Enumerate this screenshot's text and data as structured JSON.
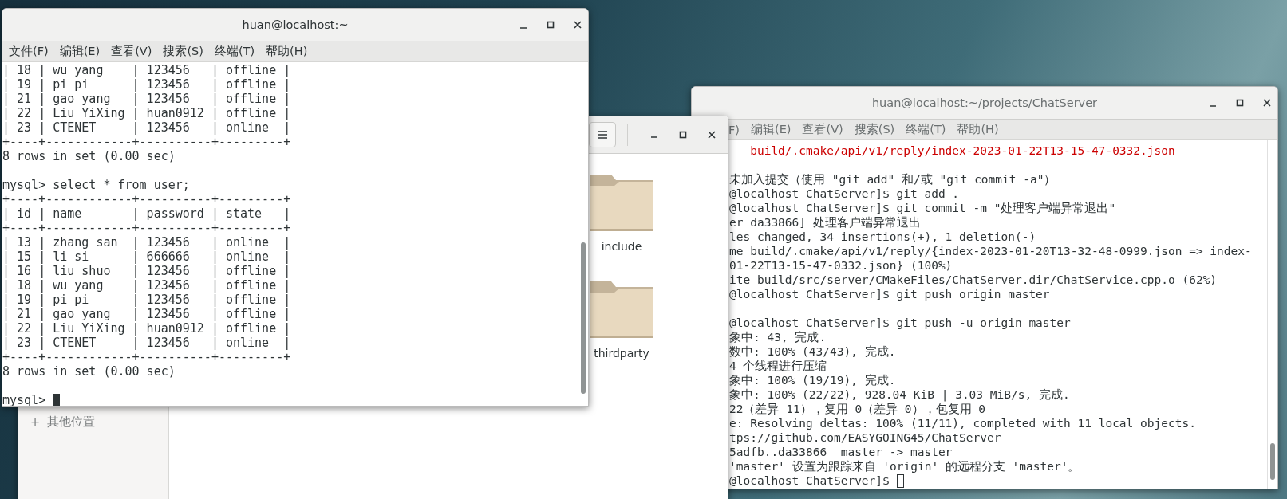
{
  "mysql_terminal": {
    "title": "huan@localhost:~",
    "focused": true,
    "menu": [
      "文件(F)",
      "编辑(E)",
      "查看(V)",
      "搜索(S)",
      "终端(T)",
      "帮助(H)"
    ],
    "lines": [
      {
        "text": "| 18 | wu yang    | 123456   | offline |",
        "kind": "normal"
      },
      {
        "text": "| 19 | pi pi      | 123456   | offline |",
        "kind": "normal"
      },
      {
        "text": "| 21 | gao yang   | 123456   | offline |",
        "kind": "normal"
      },
      {
        "text": "| 22 | Liu YiXing | huan0912 | offline |",
        "kind": "normal"
      },
      {
        "text": "| 23 | CTENET     | 123456   | online  |",
        "kind": "normal"
      },
      {
        "text": "+----+------------+----------+---------+",
        "kind": "normal"
      },
      {
        "text": "8 rows in set (0.00 sec)",
        "kind": "normal"
      },
      {
        "kind": "blank"
      },
      {
        "text": "mysql> select * from user;",
        "kind": "normal"
      },
      {
        "text": "+----+------------+----------+---------+",
        "kind": "normal"
      },
      {
        "text": "| id | name       | password | state   |",
        "kind": "normal"
      },
      {
        "text": "+----+------------+----------+---------+",
        "kind": "normal"
      },
      {
        "text": "| 13 | zhang san  | 123456   | online  |",
        "kind": "normal"
      },
      {
        "text": "| 15 | li si      | 666666   | online  |",
        "kind": "normal"
      },
      {
        "text": "| 16 | liu shuo   | 123456   | offline |",
        "kind": "normal"
      },
      {
        "text": "| 18 | wu yang    | 123456   | offline |",
        "kind": "normal"
      },
      {
        "text": "| 19 | pi pi      | 123456   | offline |",
        "kind": "normal"
      },
      {
        "text": "| 21 | gao yang   | 123456   | offline |",
        "kind": "normal"
      },
      {
        "text": "| 22 | Liu YiXing | huan0912 | offline |",
        "kind": "normal"
      },
      {
        "text": "| 23 | CTENET     | 123456   | online  |",
        "kind": "normal"
      },
      {
        "text": "+----+------------+----------+---------+",
        "kind": "normal"
      },
      {
        "text": "8 rows in set (0.00 sec)",
        "kind": "normal"
      },
      {
        "kind": "blank"
      },
      {
        "text": "mysql>",
        "kind": "prompt"
      }
    ]
  },
  "file_manager": {
    "sidebar": [
      {
        "icon": "+",
        "label": "其他位置"
      }
    ],
    "folders": [
      {
        "name": "include"
      },
      {
        "name": "thirdparty"
      }
    ]
  },
  "git_terminal": {
    "title": "huan@localhost:~/projects/ChatServer",
    "focused": false,
    "menu": [
      "F)",
      "编辑(E)",
      "查看(V)",
      "搜索(S)",
      "终端(T)",
      "帮助(H)"
    ],
    "lines": [
      {
        "text": "build/.cmake/api/v1/reply/index-2023-01-22T13-15-47-0332.json",
        "kind": "untracked"
      },
      {
        "kind": "blank"
      },
      {
        "text": "未加入提交（使用 \"git add\" 和/或 \"git commit -a\"）",
        "kind": "normal"
      },
      {
        "text": "@localhost ChatServer]$ git add .",
        "kind": "normal"
      },
      {
        "text": "@localhost ChatServer]$ git commit -m \"处理客户端异常退出\"",
        "kind": "normal"
      },
      {
        "text": "er da33866] 处理客户端异常退出",
        "kind": "normal"
      },
      {
        "text": "les changed, 34 insertions(+), 1 deletion(-)",
        "kind": "normal"
      },
      {
        "text": "me build/.cmake/api/v1/reply/{index-2023-01-20T13-32-48-0999.json => index-",
        "kind": "normal"
      },
      {
        "text": "01-22T13-15-47-0332.json} (100%)",
        "kind": "normal"
      },
      {
        "text": "ite build/src/server/CMakeFiles/ChatServer.dir/ChatService.cpp.o (62%)",
        "kind": "normal"
      },
      {
        "text": "@localhost ChatServer]$ git push origin master",
        "kind": "normal"
      },
      {
        "kind": "blank"
      },
      {
        "text": "@localhost ChatServer]$ git push -u origin master",
        "kind": "normal"
      },
      {
        "text": "象中: 43, 完成.",
        "kind": "normal"
      },
      {
        "text": "数中: 100% (43/43), 完成.",
        "kind": "normal"
      },
      {
        "text": "4 个线程进行压缩",
        "kind": "normal"
      },
      {
        "text": "象中: 100% (19/19), 完成.",
        "kind": "normal"
      },
      {
        "text": "象中: 100% (22/22), 928.04 KiB | 3.03 MiB/s, 完成.",
        "kind": "normal"
      },
      {
        "text": "22（差异 11），复用 0（差异 0），包复用 0",
        "kind": "normal"
      },
      {
        "text": "e: Resolving deltas: 100% (11/11), completed with 11 local objects.",
        "kind": "normal"
      },
      {
        "text": "tps://github.com/EASYGOING45/ChatServer",
        "kind": "normal"
      },
      {
        "text": "5adfb..da33866  master -> master",
        "kind": "normal"
      },
      {
        "text": "'master' 设置为跟踪来自 'origin' 的远程分支 'master'。",
        "kind": "normal"
      },
      {
        "text": "@localhost ChatServer]$",
        "kind": "prompt"
      }
    ]
  }
}
